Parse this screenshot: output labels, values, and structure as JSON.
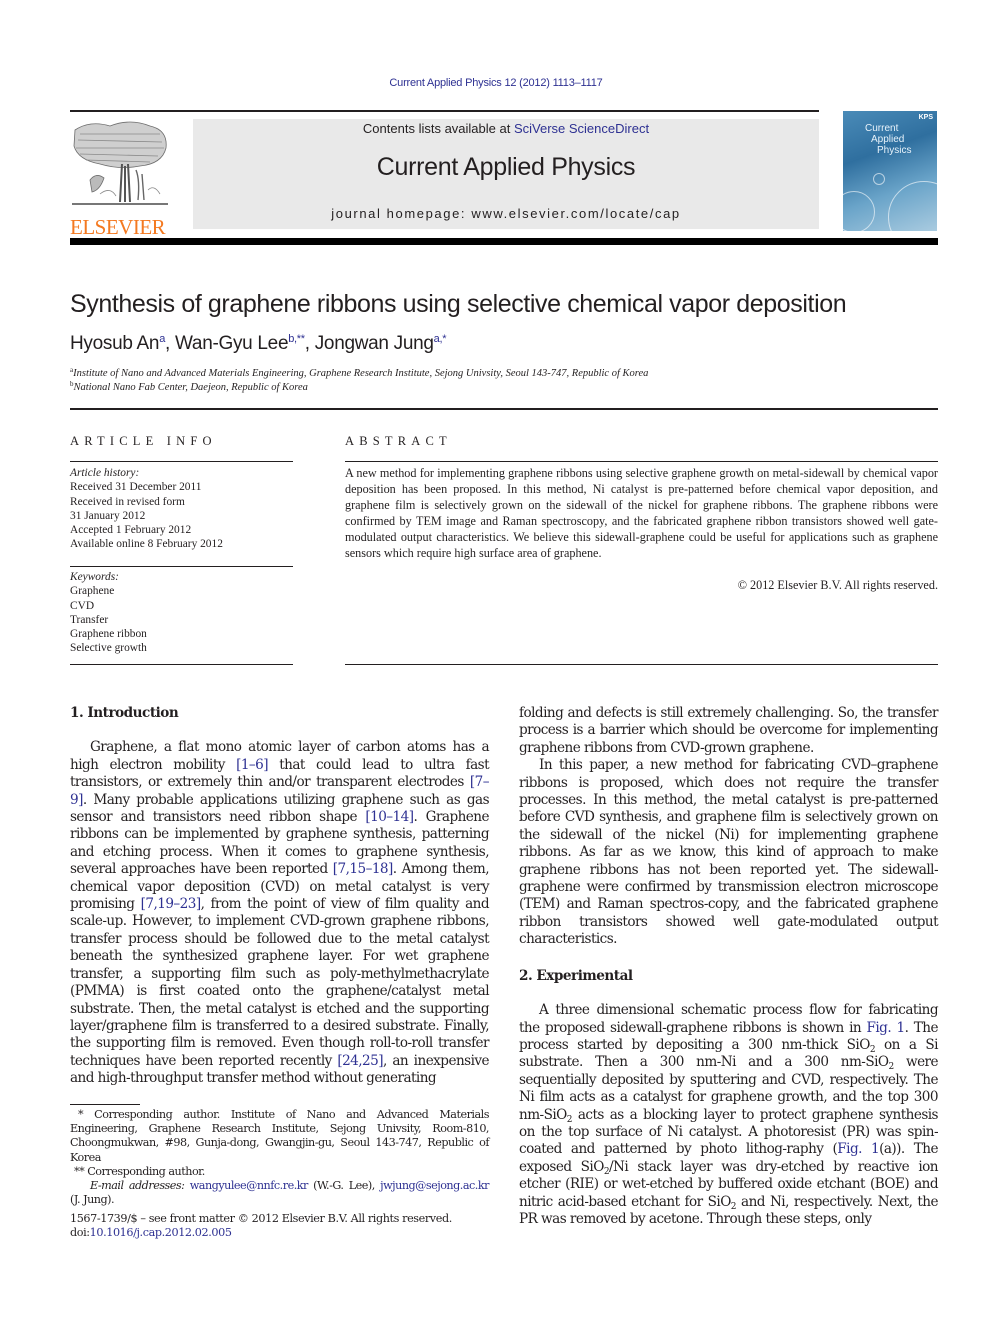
{
  "header": {
    "journal_reference": "Current Applied Physics 12 (2012) 1113–1117",
    "contents_prefix": "Contents lists available at ",
    "contents_link": "SciVerse ScienceDirect",
    "journal_title": "Current Applied Physics",
    "homepage": "journal homepage: www.elsevier.com/locate/cap",
    "publisher_logo_text": "ELSEVIER",
    "cover": {
      "title_lines": [
        "Current",
        "Applied",
        "Physics"
      ],
      "badge": "KPS"
    }
  },
  "article": {
    "title": "Synthesis of graphene ribbons using selective chemical vapor deposition",
    "authors": [
      {
        "name": "Hyosub An",
        "marks": "a"
      },
      {
        "name": "Wan-Gyu Lee",
        "marks": "b,**"
      },
      {
        "name": "Jongwan Jung",
        "marks": "a,*"
      }
    ],
    "separator": ", ",
    "affiliations": [
      {
        "mark": "a",
        "text": "Institute of Nano and Advanced Materials Engineering, Graphene Research Institute, Sejong Univsity, Seoul 143-747, Republic of Korea"
      },
      {
        "mark": "b",
        "text": "National Nano Fab Center, Daejeon, Republic of Korea"
      }
    ]
  },
  "article_info": {
    "heading": "ARTICLE INFO",
    "history_label": "Article history:",
    "history": [
      "Received 31 December 2011",
      "Received in revised form",
      "31 January 2012",
      "Accepted 1 February 2012",
      "Available online 8 February 2012"
    ],
    "keywords_label": "Keywords:",
    "keywords": [
      "Graphene",
      "CVD",
      "Transfer",
      "Graphene ribbon",
      "Selective growth"
    ]
  },
  "abstract": {
    "heading": "ABSTRACT",
    "text": "A new method for implementing graphene ribbons using selective graphene growth on metal-sidewall by chemical vapor deposition has been proposed. In this method, Ni catalyst is pre-patterned before chemical vapor deposition, and graphene film is selectively grown on the sidewall of the nickel for graphene ribbons. The graphene ribbons were confirmed by TEM image and Raman spectroscopy, and the fabricated graphene ribbon transistors showed well gate-modulated output characteristics. We believe this sidewall-graphene could be useful for applications such as graphene sensors which require high surface area of graphene.",
    "copyright": "© 2012 Elsevier B.V. All rights reserved."
  },
  "introduction": {
    "heading": "1.  Introduction",
    "p1": [
      {
        "t": "Graphene, a flat mono atomic layer of carbon atoms has a high electron mobility "
      },
      {
        "t": "[1–6]",
        "link": true
      },
      {
        "t": " that could lead to ultra fast transistors, or extremely thin and/or transparent electrodes "
      },
      {
        "t": "[7–9]",
        "link": true
      },
      {
        "t": ". Many probable applications utilizing graphene such as gas sensor and transistors need ribbon shape "
      },
      {
        "t": "[10–14]",
        "link": true
      },
      {
        "t": ". Graphene ribbons can be implemented by graphene synthesis, patterning and etching process. When it comes to graphene synthesis, several approaches have been reported "
      },
      {
        "t": "[7,15–18]",
        "link": true
      },
      {
        "t": ". Among them, chemical vapor deposition (CVD) on metal catalyst is very promising "
      },
      {
        "t": "[7,19–23]",
        "link": true
      },
      {
        "t": ", from the point of view of film quality and scale-up. However, to implement CVD-grown graphene ribbons, transfer process should be followed due to the metal catalyst beneath the synthesized graphene layer. For wet graphene transfer, a supporting film such as poly-methylmethacrylate (PMMA) is first coated onto the graphene/catalyst metal substrate. Then, the metal catalyst is etched and the supporting layer/graphene film is transferred to a desired substrate. Finally, the supporting film is removed. Even though roll-to-roll transfer techniques have been reported recently "
      },
      {
        "t": "[24,25]",
        "link": true
      },
      {
        "t": ", an inexpensive and high-throughput transfer method without generating"
      }
    ],
    "p1_cont": "folding and defects is still extremely challenging. So, the transfer process is a barrier which should be overcome for implementing graphene ribbons from CVD-grown graphene.",
    "p2": "In this paper, a new method for fabricating CVD–graphene ribbons is proposed, which does not require the transfer processes. In this method, the metal catalyst is pre-patterned before CVD synthesis, and graphene film is selectively grown on the sidewall of the nickel (Ni) for implementing graphene ribbons. As far as we know, this kind of approach to make graphene ribbons has not been reported yet. The sidewall-graphene were confirmed by transmission electron microscope (TEM) and Raman spectros-copy, and the fabricated graphene ribbon transistors showed well gate-modulated output characteristics."
  },
  "experimental": {
    "heading": "2.  Experimental",
    "p1": [
      {
        "t": "A three dimensional schematic process flow for fabricating the proposed sidewall-graphene ribbons is shown in "
      },
      {
        "t": "Fig. 1",
        "link": true
      },
      {
        "t": ". The process started by depositing a 300 nm-thick SiO"
      },
      {
        "t": "2",
        "sub": true
      },
      {
        "t": " on a Si substrate. Then a 300 nm-Ni and a 300 nm-SiO"
      },
      {
        "t": "2",
        "sub": true
      },
      {
        "t": " were sequentially deposited by sputtering and CVD, respectively. The Ni film acts as a catalyst for graphene growth, and the top 300 nm-SiO"
      },
      {
        "t": "2",
        "sub": true
      },
      {
        "t": " acts as a blocking layer to protect graphene synthesis on the top surface of Ni catalyst. A photoresist (PR) was spin-coated and patterned by photo lithog-raphy ("
      },
      {
        "t": "Fig. 1",
        "link": true
      },
      {
        "t": "(a)). The exposed SiO"
      },
      {
        "t": "2",
        "sub": true
      },
      {
        "t": "/Ni stack layer was dry-etched by reactive ion etcher (RIE) or wet-etched by buffered oxide etchant (BOE) and nitric acid-based etchant for SiO"
      },
      {
        "t": "2",
        "sub": true
      },
      {
        "t": " and Ni, respectively. Next, the PR was removed by acetone. Through these steps, only"
      }
    ]
  },
  "footnotes": {
    "corr1_mark": "*",
    "corr1": " Corresponding author. Institute of Nano and Advanced Materials Engineering, Graphene Research Institute, Sejong Univsity, Room-810, Choongmukwan, #98, Gunja-dong, Gwangjin-gu, Seoul 143-747, Republic of Korea",
    "corr2_mark": "**",
    "corr2": " Corresponding author.",
    "email_label": "E-mail addresses:",
    "email1": "wangyulee@nnfc.re.kr",
    "email1_owner": " (W.-G. Lee), ",
    "email2": "jwjung@sejong.ac.kr",
    "email2_owner": " (J. Jung)."
  },
  "front_matter": {
    "issn_line": "1567-1739/$ – see front matter © 2012 Elsevier B.V. All rights reserved.",
    "doi_label": "doi:",
    "doi": "10.1016/j.cap.2012.02.005"
  },
  "colors": {
    "link": "#2e3192",
    "elsevier_orange": "#f47920",
    "masthead_bg": "#e9e9e9"
  }
}
